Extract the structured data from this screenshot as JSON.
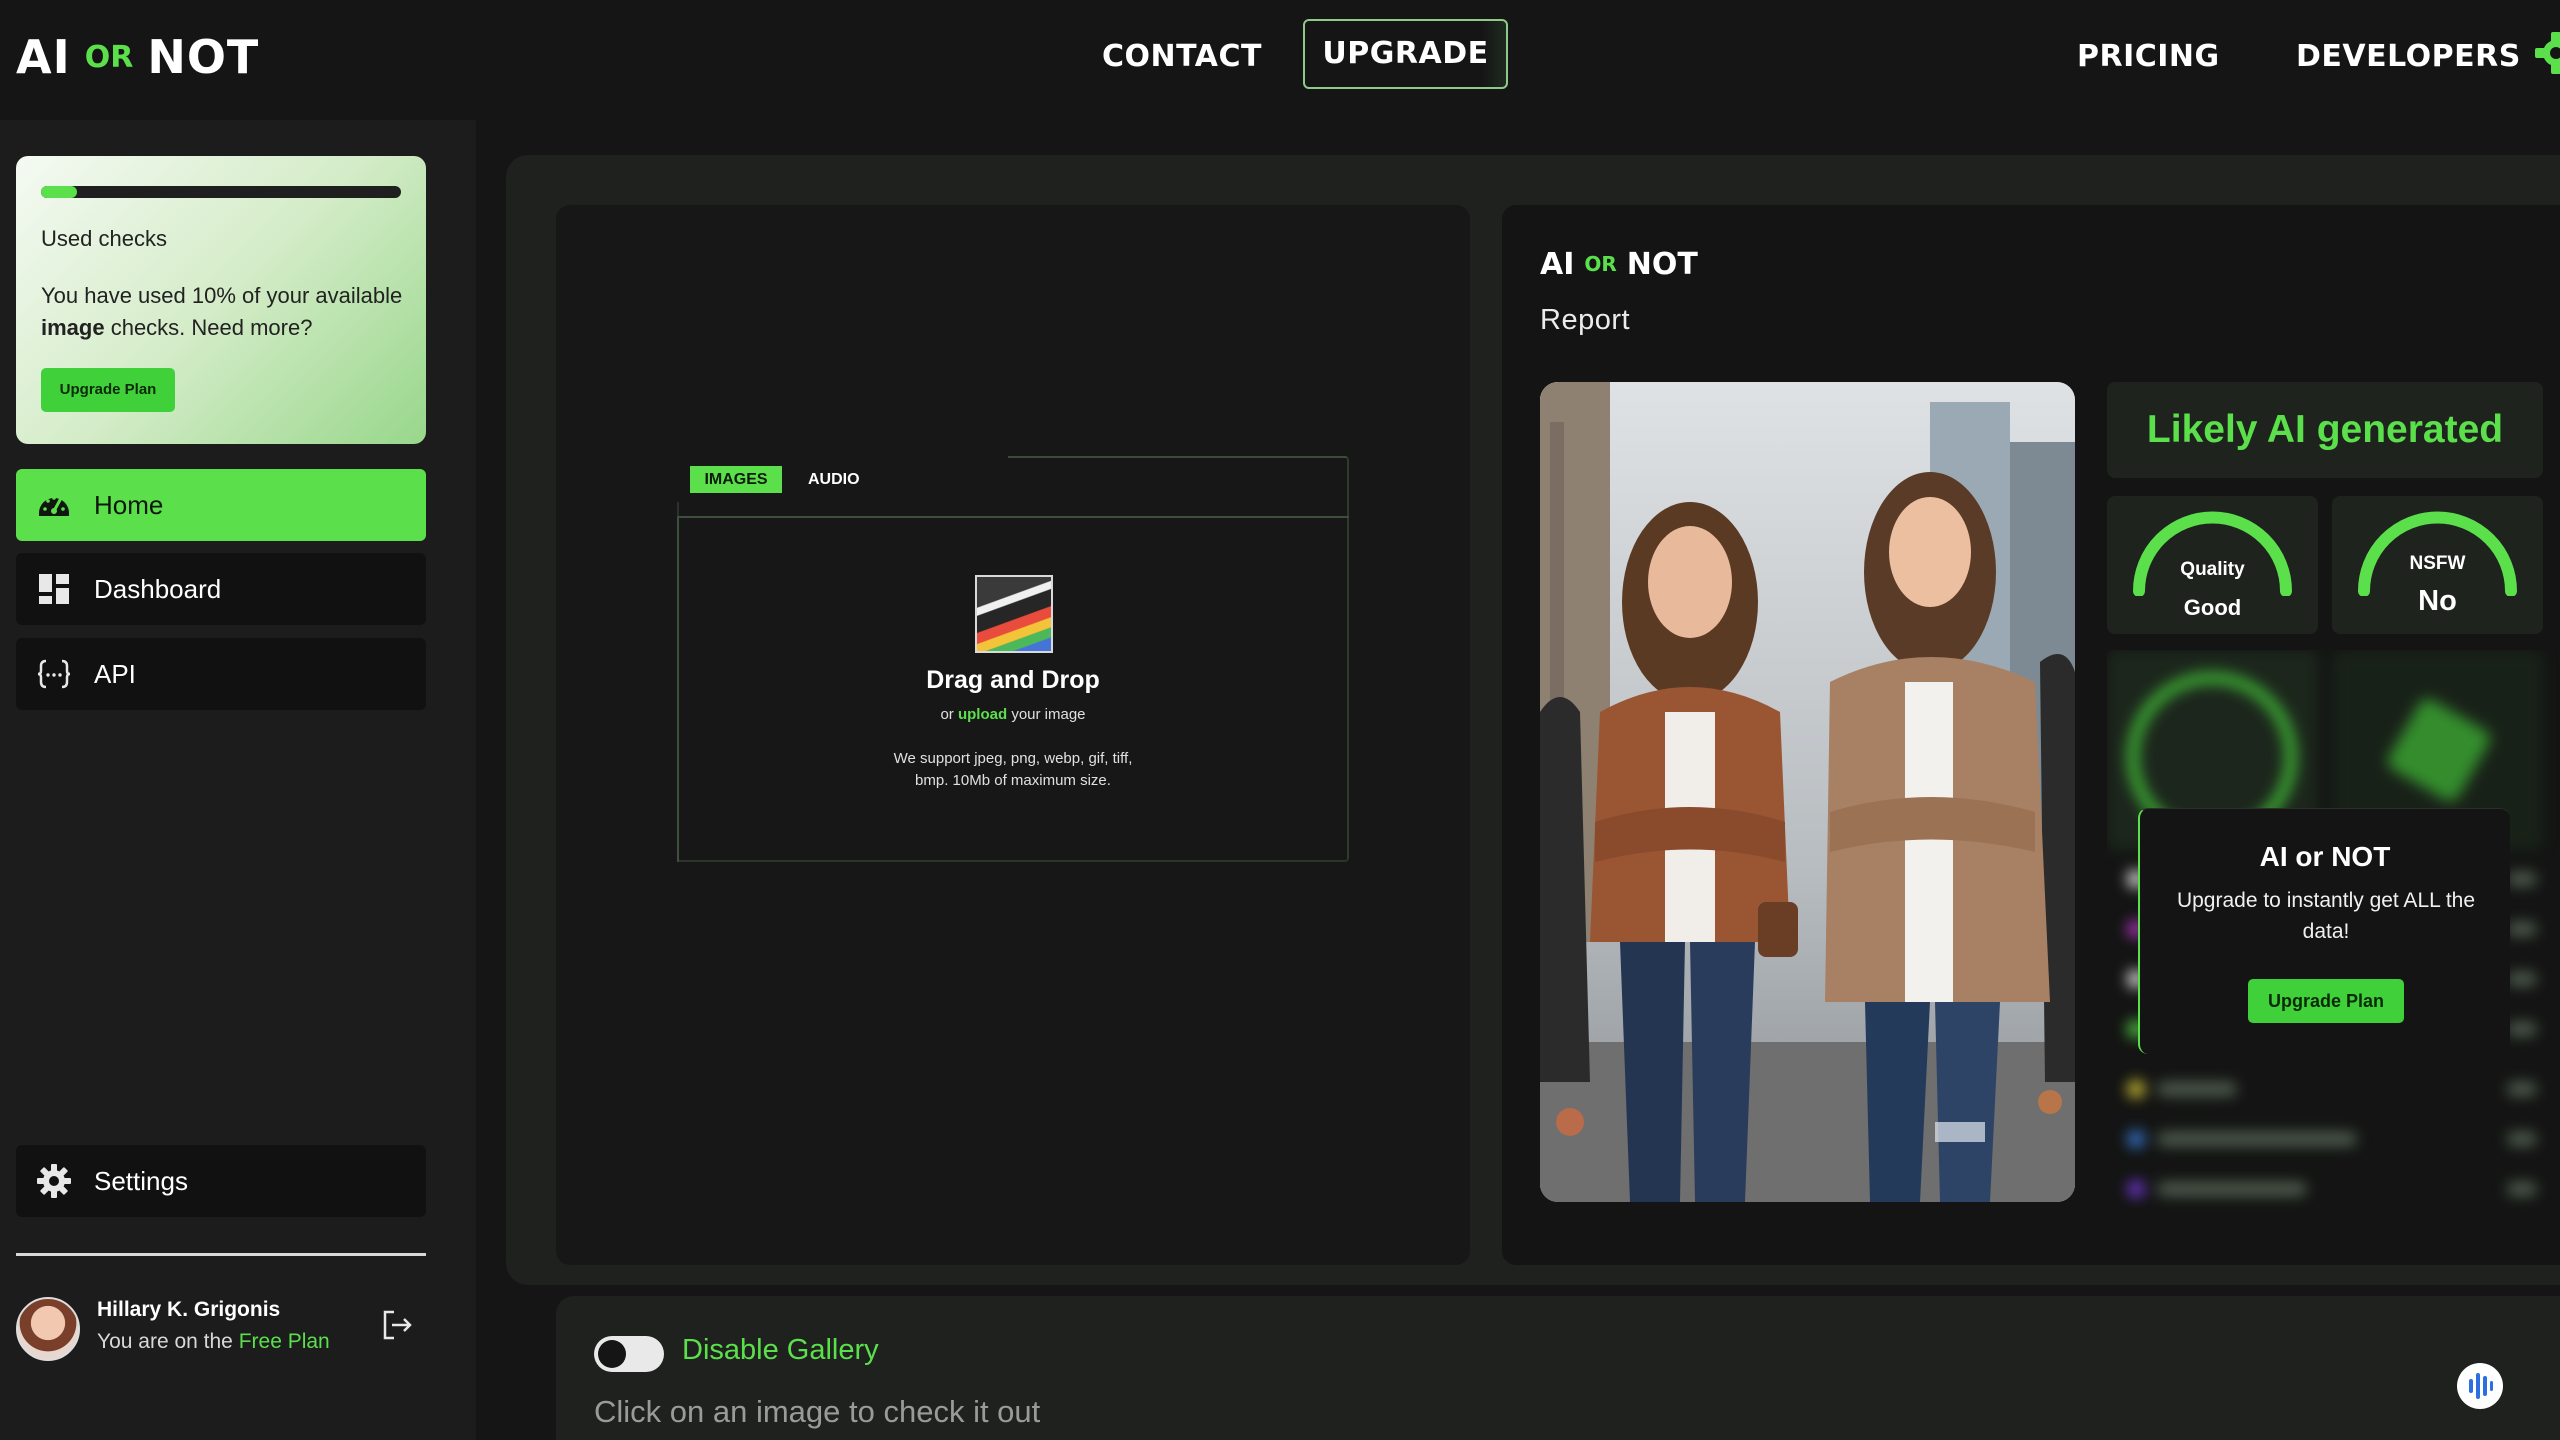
{
  "header": {
    "logo": {
      "left": "AI",
      "or": "OR",
      "right": "NOT"
    },
    "nav": {
      "contact": "CONTACT",
      "upgrade": "UPGRADE",
      "pricing": "PRICING",
      "developers": "DEVELOPERS"
    }
  },
  "sidebar": {
    "usage": {
      "title": "Used checks",
      "text_prefix": "You have used 10% of your available ",
      "text_bold": "image",
      "text_suffix": " checks. Need more?",
      "used_fraction": 0.1,
      "button": "Upgrade Plan"
    },
    "items": [
      {
        "label": "Home",
        "icon": "speedometer-icon"
      },
      {
        "label": "Dashboard",
        "icon": "dashboard-grid-icon"
      },
      {
        "label": "API",
        "icon": "braces-icon"
      }
    ],
    "settings": {
      "label": "Settings",
      "icon": "gear-icon"
    },
    "user": {
      "name": "Hillary K. Grigonis",
      "plan_prefix": "You are on the ",
      "plan_name": "Free Plan"
    }
  },
  "upload": {
    "tabs": {
      "images": "IMAGES",
      "audio": "AUDIO"
    },
    "title": "Drag and Drop",
    "sub_prefix": "or ",
    "sub_link": "upload",
    "sub_suffix": " your image",
    "support_line1": "We support jpeg, png, webp, gif, tiff,",
    "support_line2": "bmp. 10Mb of maximum size."
  },
  "report": {
    "logo": {
      "left": "AI",
      "or": "OR",
      "right": "NOT"
    },
    "subtitle": "Report",
    "verdict": "Likely AI generated",
    "quality": {
      "label": "Quality",
      "value": "Good"
    },
    "nsfw": {
      "label": "NSFW",
      "value": "No"
    },
    "upsell": {
      "title": "AI or NOT",
      "text": "Upgrade to instantly get ALL the data!",
      "button": "Upgrade Plan"
    }
  },
  "gallery": {
    "toggle_label": "Disable Gallery",
    "hint": "Click on an image to check it out"
  },
  "colors": {
    "accent": "#5be04b",
    "background": "#151515",
    "panel": "#1e211e"
  }
}
